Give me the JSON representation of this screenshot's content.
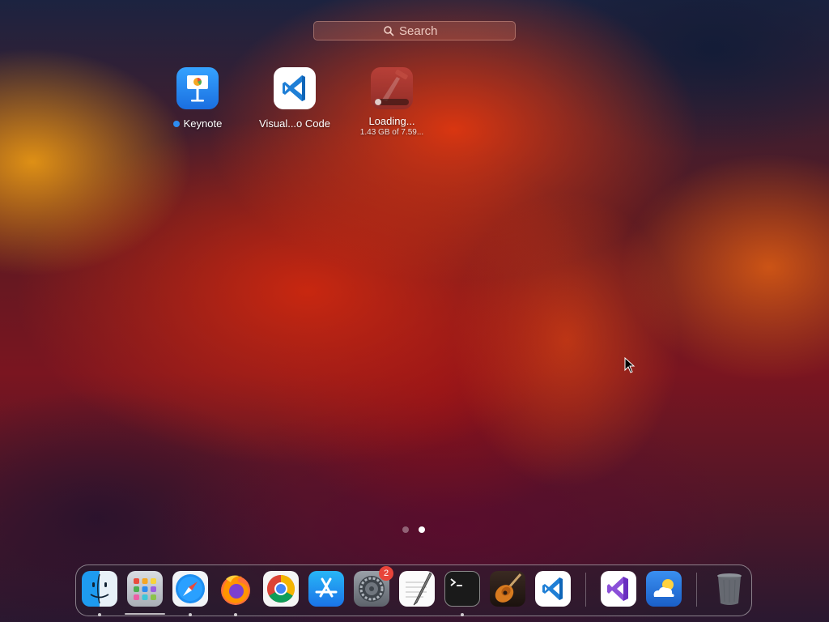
{
  "search": {
    "placeholder": "Search",
    "icon": "search-icon"
  },
  "apps": [
    {
      "name": "Keynote",
      "label": "Keynote",
      "new_indicator": true
    },
    {
      "name": "Visual Studio Code",
      "label": "Visual...o Code"
    },
    {
      "name": "Xcode",
      "label": "Loading...",
      "sublabel": "1.43 GB of 7.59...",
      "progress": 0.19
    }
  ],
  "page_indicator": {
    "pages": 2,
    "current": 2
  },
  "dock": {
    "items": [
      {
        "id": "finder",
        "icon": "finder-icon",
        "running": true
      },
      {
        "id": "launchpad",
        "icon": "launchpad-icon",
        "running": false,
        "active": true
      },
      {
        "id": "safari",
        "icon": "safari-icon",
        "running": true
      },
      {
        "id": "firefox",
        "icon": "firefox-icon",
        "running": true
      },
      {
        "id": "chrome",
        "icon": "chrome-icon",
        "running": false
      },
      {
        "id": "app-store",
        "icon": "app-store-icon",
        "running": false
      },
      {
        "id": "system-settings",
        "icon": "gear-icon",
        "running": false,
        "badge": "2"
      },
      {
        "id": "textedit",
        "icon": "textedit-icon",
        "running": false
      },
      {
        "id": "terminal",
        "icon": "terminal-icon",
        "running": true
      },
      {
        "id": "garageband",
        "icon": "guitar-icon",
        "running": false
      },
      {
        "id": "vscode",
        "icon": "vscode-icon",
        "running": false
      },
      {
        "id": "visual-studio",
        "icon": "visual-studio-icon",
        "running": false
      },
      {
        "id": "weather",
        "icon": "weather-icon",
        "running": false
      },
      {
        "id": "trash",
        "icon": "trash-icon",
        "running": false
      }
    ]
  },
  "colors": {
    "badge": "#e8443a",
    "new_indicator": "#2d8cf0",
    "keynote_blue": "#1e88f0",
    "vscode_blue": "#1f7fd6"
  }
}
